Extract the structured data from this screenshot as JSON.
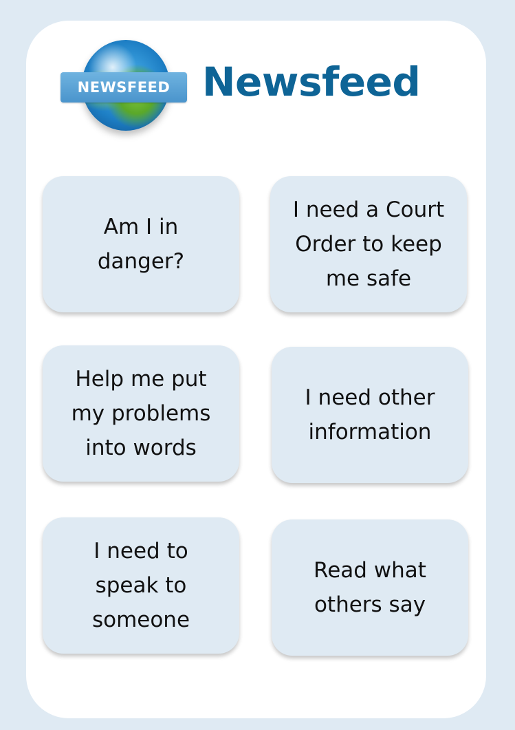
{
  "header": {
    "logo_text": "NEWSFEED",
    "title": "Newsfeed"
  },
  "menu": {
    "items": [
      {
        "label": "Am I in danger?"
      },
      {
        "label": "I need a Court Order to keep me safe"
      },
      {
        "label": "Help me put my problems into words"
      },
      {
        "label": "I need other information"
      },
      {
        "label": "I need to speak to someone"
      },
      {
        "label": "Read what others say"
      }
    ]
  },
  "colors": {
    "background": "#dfeaf3",
    "card": "#ffffff",
    "tile": "#dfeaf3",
    "title": "#0e6496",
    "logo_band": "#4a94cc"
  },
  "icons": {
    "logo": "globe-icon"
  }
}
